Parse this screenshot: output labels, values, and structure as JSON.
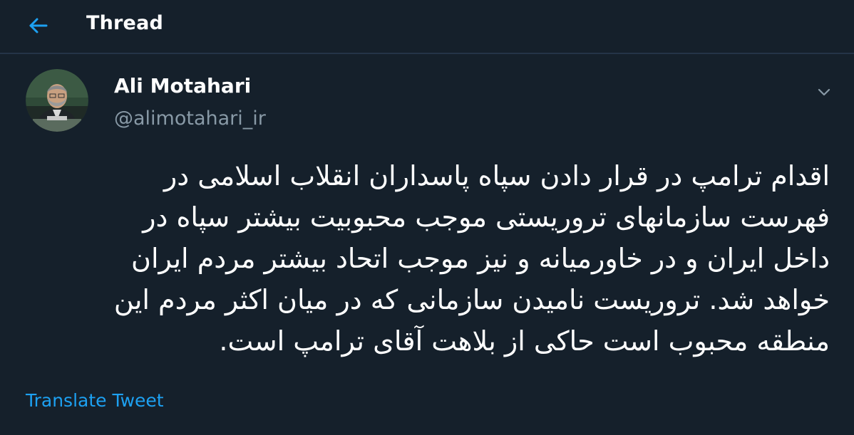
{
  "header": {
    "back_icon": "arrow-left-icon",
    "title": "Thread"
  },
  "tweet": {
    "author": {
      "name": "Ali Motahari",
      "handle": "@alimotahari_ir",
      "avatar": "profile-photo"
    },
    "menu_icon": "chevron-down-icon",
    "text": "اقدام ترامپ در قرار دادن سپاه پاسداران انقلاب اسلامی در\nفهرست سازمانهای تروریستی موجب محبوبیت بیشتر سپاه در\nداخل ایران و در خاورمیانه و نیز موجب اتحاد بیشتر مردم ایران\nخواهد شد. تروریست نامیدن سازمانی که در میان اکثر مردم این\nمنطقه محبوب است حاکی از بلاهت آقای ترامپ است.",
    "translate_label": "Translate Tweet"
  },
  "colors": {
    "background": "#15202b",
    "divider": "#243447",
    "accent": "#1da1f2",
    "secondary_text": "#8899a6",
    "primary_text": "#ffffff"
  }
}
